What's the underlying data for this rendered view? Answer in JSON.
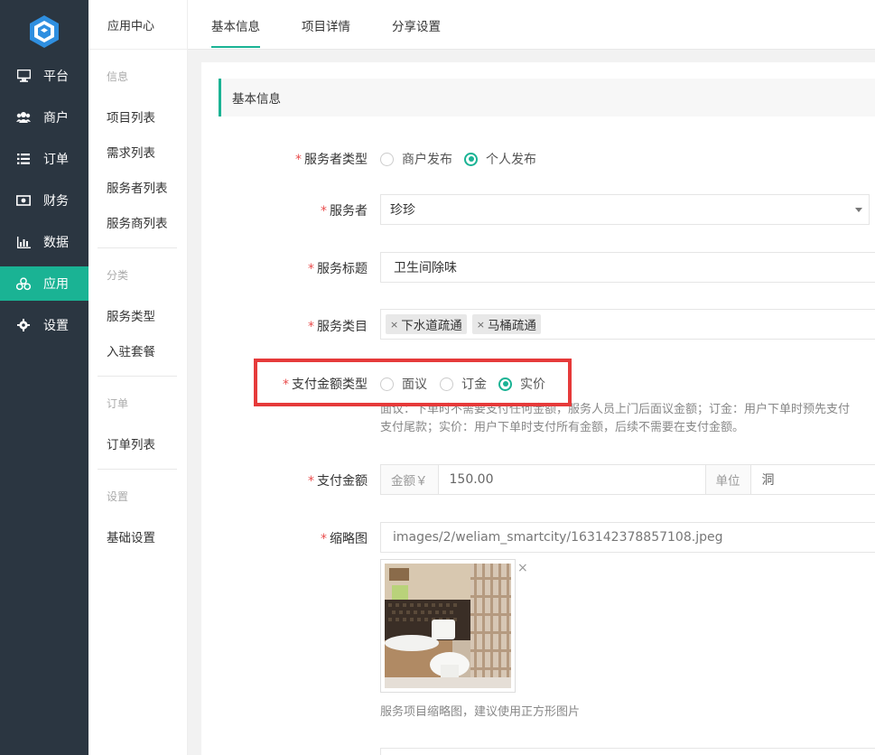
{
  "nav_main": [
    {
      "label": "平台",
      "icon": "monitor-icon"
    },
    {
      "label": "商户",
      "icon": "users-icon"
    },
    {
      "label": "订单",
      "icon": "list-icon"
    },
    {
      "label": "财务",
      "icon": "money-icon"
    },
    {
      "label": "数据",
      "icon": "bar-chart-icon"
    },
    {
      "label": "应用",
      "icon": "apps-icon",
      "active": true
    },
    {
      "label": "设置",
      "icon": "gear-icon"
    }
  ],
  "nav_sub": {
    "header": "应用中心",
    "groups": [
      {
        "title": "信息",
        "items": [
          "项目列表",
          "需求列表",
          "服务者列表",
          "服务商列表"
        ]
      },
      {
        "title": "分类",
        "items": [
          "服务类型",
          "入驻套餐"
        ]
      },
      {
        "title": "订单",
        "items": [
          "订单列表"
        ]
      },
      {
        "title": "设置",
        "items": [
          "基础设置"
        ]
      }
    ]
  },
  "tabs": [
    "基本信息",
    "项目详情",
    "分享设置"
  ],
  "section_title": "基本信息",
  "form": {
    "provider_type": {
      "label": "服务者类型",
      "options": [
        "商户发布",
        "个人发布"
      ],
      "selected": "个人发布"
    },
    "provider": {
      "label": "服务者",
      "value": "珍珍"
    },
    "title": {
      "label": "服务标题",
      "value": "卫生间除味"
    },
    "category": {
      "label": "服务类目",
      "tags": [
        "下水道疏通",
        "马桶疏通"
      ]
    },
    "pay_type": {
      "label": "支付金额类型",
      "options": [
        "面议",
        "订金",
        "实价"
      ],
      "selected": "实价",
      "help_line1": "面议：下单时不需要支付任何金额，服务人员上门后面议金额；订金：用户下单时预先支付",
      "help_line2": "支付尾款；实价：用户下单时支付所有金额，后续不需要在支付金额。"
    },
    "amount": {
      "label": "支付金额",
      "prefix": "金额￥",
      "value": "150.00",
      "unit_label": "单位",
      "unit_value": "洞"
    },
    "thumbnail": {
      "label": "缩略图",
      "path": "images/2/weliam_smartcity/163142378857108.jpeg",
      "close": "×",
      "help": "服务项目缩略图，建议使用正方形图片"
    }
  },
  "colors": {
    "accent": "#1ab394",
    "sidebar": "#2b3641",
    "required": "#e94c4c",
    "highlight": "#e63a3a"
  }
}
